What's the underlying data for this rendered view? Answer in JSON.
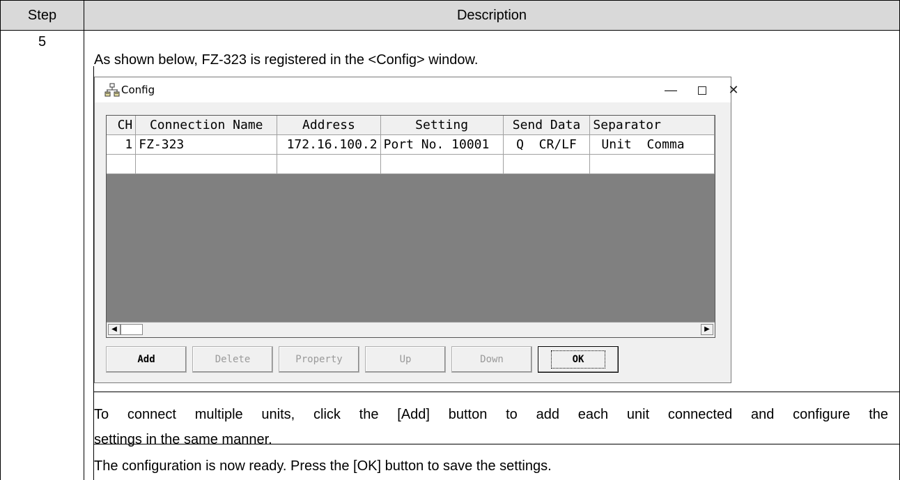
{
  "table": {
    "header_step": "Step",
    "header_description": "Description",
    "step_number": "5",
    "intro": "As shown below, FZ-323 is registered in the <Config> window.",
    "note_line1": "To connect multiple units, click the [Add] button to add each unit connected and configure the",
    "note_line2": "settings in the same manner.",
    "closing": "The configuration is now ready. Press the [OK] button to save the settings."
  },
  "window": {
    "title": "Config",
    "icon": "network-config-icon",
    "controls": {
      "minimize": "—",
      "close": "✕"
    }
  },
  "grid": {
    "columns": [
      "CH",
      "Connection Name",
      "Address",
      "Setting",
      "Send Data",
      "Separator"
    ],
    "rows": [
      {
        "ch": "1",
        "name": "FZ-323",
        "address": "172.16.100.2",
        "setting": "Port No. 10001",
        "send": "Q  CR/LF",
        "separator": "Unit  Comma"
      }
    ]
  },
  "buttons": {
    "add": "Add",
    "delete": "Delete",
    "property": "Property",
    "up": "Up",
    "down": "Down",
    "ok": "OK"
  }
}
